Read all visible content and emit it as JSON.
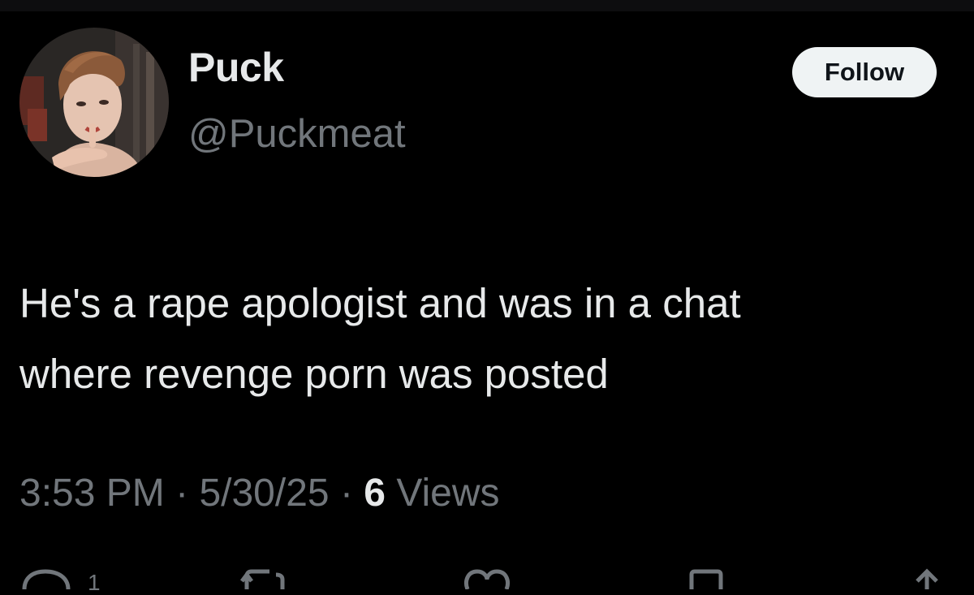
{
  "tweet": {
    "author": {
      "display_name": "Puck",
      "handle": "@Puckmeat",
      "avatar_icon": "profile-photo"
    },
    "follow_label": "Follow",
    "text_lines": [
      "He's a rape apologist and was in a chat",
      "where revenge porn was posted"
    ],
    "time": "3:53 PM",
    "date": "5/30/25",
    "separator": "·",
    "views_count": "6",
    "views_label": "Views",
    "actions": {
      "reply_count": "1",
      "icons": [
        "reply-icon",
        "retweet-icon",
        "like-icon",
        "bookmark-icon",
        "share-icon"
      ]
    }
  },
  "colors": {
    "background": "#000000",
    "primary_text": "#e7e9ea",
    "secondary_text": "#71767b",
    "follow_bg": "#eff3f4",
    "follow_text": "#0f1419"
  }
}
